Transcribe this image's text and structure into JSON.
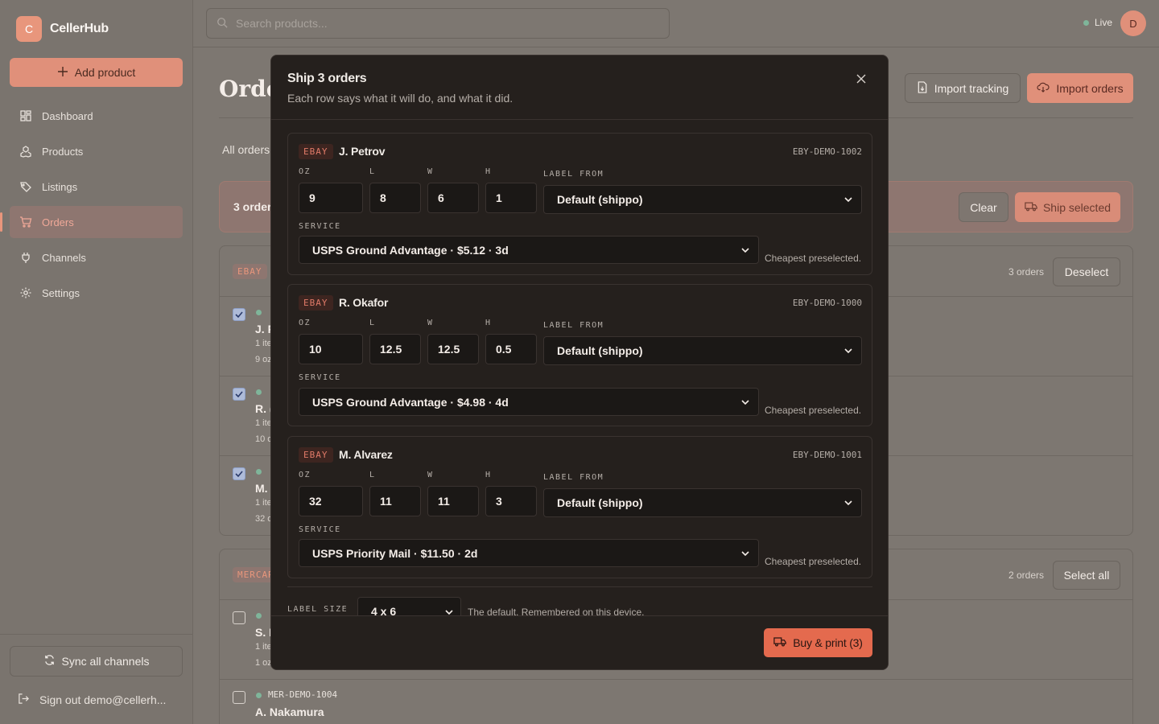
{
  "app": {
    "logo_letter": "C",
    "name": "CellerHub"
  },
  "sidebar": {
    "add_product": "Add product",
    "items": [
      {
        "label": "Dashboard",
        "icon": "dashboard-icon"
      },
      {
        "label": "Products",
        "icon": "products-icon"
      },
      {
        "label": "Listings",
        "icon": "tag-icon"
      },
      {
        "label": "Orders",
        "icon": "cart-icon",
        "active": true
      },
      {
        "label": "Channels",
        "icon": "plug-icon"
      },
      {
        "label": "Settings",
        "icon": "gear-icon"
      }
    ],
    "sync": "Sync all channels",
    "signout": "Sign out demo@cellerh..."
  },
  "topbar": {
    "search_placeholder": "Search products...",
    "live": "Live",
    "avatar": "D"
  },
  "page": {
    "title": "Orde",
    "import_tracking": "Import tracking",
    "import_orders": "Import orders",
    "tab_all": "All orders",
    "selection_text": "3 orders",
    "clear": "Clear",
    "ship_selected": "Ship selected",
    "groups": [
      {
        "channel": "EBAY",
        "count": "3 orders",
        "button": "Deselect",
        "rows": [
          {
            "name": "J. P",
            "sub1": "1 ite",
            "sub2": "9 oz",
            "checked": true
          },
          {
            "name": "R. (",
            "sub1": "1 ite",
            "sub2": "10 o",
            "checked": true
          },
          {
            "name": "M.",
            "sub1": "1 ite",
            "sub2": "32 o",
            "checked": true
          }
        ]
      },
      {
        "channel": "MERCAR",
        "count": "2 orders",
        "button": "Select all",
        "rows": [
          {
            "name": "S. I",
            "sub1": "1 ite",
            "sub2": "1 oz",
            "checked": false,
            "sku": ""
          },
          {
            "name": "A. Nakamura",
            "sub1": "",
            "sub2": "",
            "checked": false,
            "sku": "MER-DEMO-1004"
          }
        ]
      }
    ]
  },
  "modal": {
    "title": "Ship 3 orders",
    "subtitle": "Each row says what it will do, and what it did.",
    "labels": {
      "oz": "OZ",
      "l": "L",
      "w": "W",
      "h": "H",
      "label_from": "LABEL FROM",
      "service": "SERVICE"
    },
    "hint": "Cheapest preselected.",
    "cards": [
      {
        "channel": "EBAY",
        "name": "J. Petrov",
        "sku": "EBY-DEMO-1002",
        "oz": "9",
        "l": "8",
        "w": "6",
        "h": "1",
        "label_from": "Default (shippo)",
        "service": "USPS Ground Advantage · $5.12 · 3d"
      },
      {
        "channel": "EBAY",
        "name": "R. Okafor",
        "sku": "EBY-DEMO-1000",
        "oz": "10",
        "l": "12.5",
        "w": "12.5",
        "h": "0.5",
        "label_from": "Default (shippo)",
        "service": "USPS Ground Advantage · $4.98 · 4d"
      },
      {
        "channel": "EBAY",
        "name": "M. Alvarez",
        "sku": "EBY-DEMO-1001",
        "oz": "32",
        "l": "11",
        "w": "11",
        "h": "3",
        "label_from": "Default (shippo)",
        "service": "USPS Priority Mail · $11.50 · 2d"
      }
    ],
    "label_size_label": "LABEL SIZE",
    "label_size": "4 x 6",
    "label_size_hint": "The default. Remembered on this device.",
    "buy": "Buy & print (3)"
  },
  "colors": {
    "accent": "#e46a4e",
    "badge_text": "#e07a68",
    "status_dot": "#7fb59a"
  }
}
